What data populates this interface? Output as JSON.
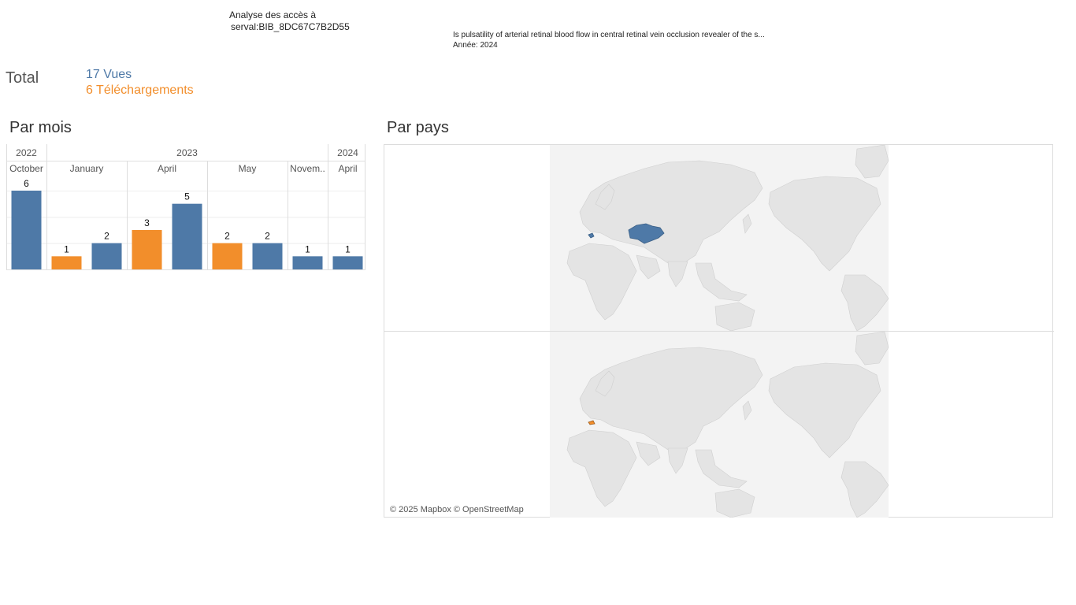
{
  "header": {
    "title_line1": "Analyse des accès à",
    "title_line2": "serval:BIB_8DC67C7B2D55",
    "doc_title": "Is pulsatility of arterial retinal blood flow in central retinal vein occlusion revealer of the s...",
    "doc_year": "Année: 2024"
  },
  "totals": {
    "label": "Total",
    "views": "17 Vues",
    "downloads": "6 Téléchargements",
    "views_color": "#4e79a7",
    "downloads_color": "#f28e2b"
  },
  "sections": {
    "by_month": "Par mois",
    "by_country": "Par pays"
  },
  "chart_data": {
    "type": "bar",
    "title": "Par mois",
    "years": [
      {
        "label": "2022"
      },
      {
        "label": "2023"
      },
      {
        "label": "2024"
      }
    ],
    "months": [
      {
        "label": "October",
        "year": "2022",
        "bars": [
          {
            "series": "Vues",
            "value": 6
          }
        ]
      },
      {
        "label": "January",
        "year": "2023",
        "bars": [
          {
            "series": "Téléchargements",
            "value": 1
          },
          {
            "series": "Vues",
            "value": 2
          }
        ]
      },
      {
        "label": "April",
        "year": "2023",
        "bars": [
          {
            "series": "Téléchargements",
            "value": 3
          },
          {
            "series": "Vues",
            "value": 5
          }
        ]
      },
      {
        "label": "May",
        "year": "2023",
        "bars": [
          {
            "series": "Téléchargements",
            "value": 2
          },
          {
            "series": "Vues",
            "value": 2
          }
        ]
      },
      {
        "label": "Novem..",
        "year": "2023",
        "bars": [
          {
            "series": "Vues",
            "value": 1
          }
        ]
      },
      {
        "label": "April",
        "year": "2024",
        "bars": [
          {
            "series": "Vues",
            "value": 1
          }
        ]
      }
    ],
    "ylim": [
      0,
      7
    ],
    "grid": true,
    "series_colors": {
      "Vues": "#4e79a7",
      "Téléchargements": "#f28e2b"
    }
  },
  "map": {
    "attribution": "© 2025 Mapbox © OpenStreetMap",
    "land_color": "#e6e6e6",
    "border_color": "#cfcfcf",
    "highlight_views": [
      {
        "country": "Kazakhstan",
        "color": "#4e79a7"
      },
      {
        "country": "France",
        "color": "#4e79a7"
      }
    ],
    "highlight_downloads": [
      {
        "country": "Switzerland",
        "color": "#f28e2b"
      }
    ]
  }
}
